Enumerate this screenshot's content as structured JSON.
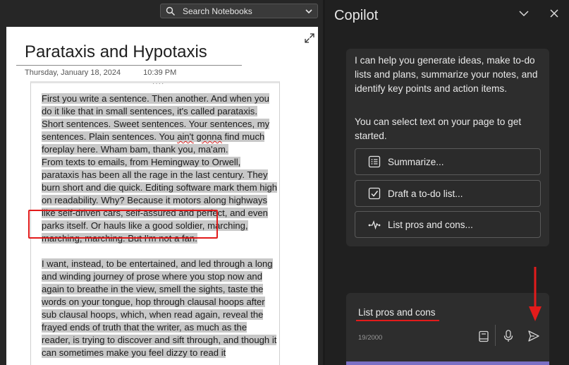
{
  "search": {
    "placeholder": "Search Notebooks"
  },
  "page": {
    "title": "Parataxis and Hypotaxis",
    "date": "Thursday, January 18, 2024",
    "time": "10:39 PM",
    "paragraph1_pre": "First you write a sentence. Then another. And when you do it like that in small sentences, it's called parataxis. Short sentences. Sweet sentences. Your sentences, my sentences. Plain sentences. You ",
    "paragraph1_err1": "ain't",
    "paragraph1_sp": " ",
    "paragraph1_err2": "gonna",
    "paragraph1_post": " find much foreplay here. Wham bam, thank you, ma'am.",
    "paragraph2": "From texts to emails, from Hemingway to Orwell, parataxis has been all the rage in the last century. They burn short and die quick. Editing software mark them high on readability. Why? Because it motors along highways like self-driven cars, self-assured and perfect, and even parks itself. Or hauls like a good soldier, marching, marching, marching. But I'm not a fan.",
    "paragraph3": "I want, instead, to be entertained, and led through a long and winding journey of prose where you stop now and again to breathe in the view, smell the sights, taste the words on your tongue, hop through clausal hoops after sub clausal hoops, which, when read again, reveal the frayed ends of truth that the writer, as much as the reader, is trying to discover and sift through, and though it can sometimes make you feel dizzy to read it"
  },
  "copilot": {
    "title": "Copilot",
    "intro": "I can help you generate ideas, make to-do lists and plans, summarize your notes, and identify key points and action items.",
    "intro2": "You can select text on your page to get started.",
    "options": [
      {
        "label": "Summarize...",
        "icon": "list-icon"
      },
      {
        "label": "Draft a to-do list...",
        "icon": "checkbox-icon"
      },
      {
        "label": "List pros and cons...",
        "icon": "pulse-icon"
      }
    ],
    "compose": {
      "text": "List pros and cons",
      "count": "19/2000"
    }
  },
  "colors": {
    "accent_red": "#e21b1b",
    "accent_purple": "#7b70c4",
    "selection": "#c8c8c8"
  }
}
